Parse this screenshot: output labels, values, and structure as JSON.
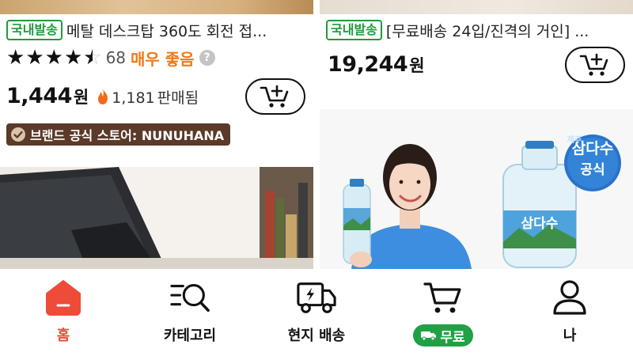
{
  "products": [
    {
      "domestic_badge": "국내발송",
      "title": "메탈 데스크탑 360도 회전 접...",
      "rating_stars": 4.5,
      "review_count": "68",
      "rating_word": "매우 좋음",
      "help_icon": "?",
      "price": "1,444",
      "currency": "원",
      "sold_count": "1,181",
      "sold_label": "판매됨",
      "store_badge": "브랜드 공식 스토어: NUNUHANA"
    },
    {
      "domestic_badge": "국내발송",
      "title": "[무료배송 24입/진격의 거인] ...",
      "price": "19,244",
      "currency": "원"
    }
  ],
  "water_ad": {
    "brand": "삼다수",
    "brand_prefix": "제주",
    "official_label": "공식",
    "bottle_label": "삼다수"
  },
  "bottom_nav": [
    {
      "label": "홈",
      "icon": "home-icon",
      "active": true
    },
    {
      "label": "카테고리",
      "icon": "category-search-icon",
      "active": false
    },
    {
      "label": "현지 배송",
      "icon": "delivery-truck-icon",
      "active": false
    },
    {
      "label": "무료",
      "icon": "cart-icon",
      "active": false
    },
    {
      "label": "나",
      "icon": "person-icon",
      "active": false
    }
  ],
  "colors": {
    "accent_red": "#ee4b38",
    "domestic_green": "#1e9b3c",
    "free_green": "#21a045",
    "rating_orange": "#f07a16",
    "store_brown": "#5b3a29"
  }
}
